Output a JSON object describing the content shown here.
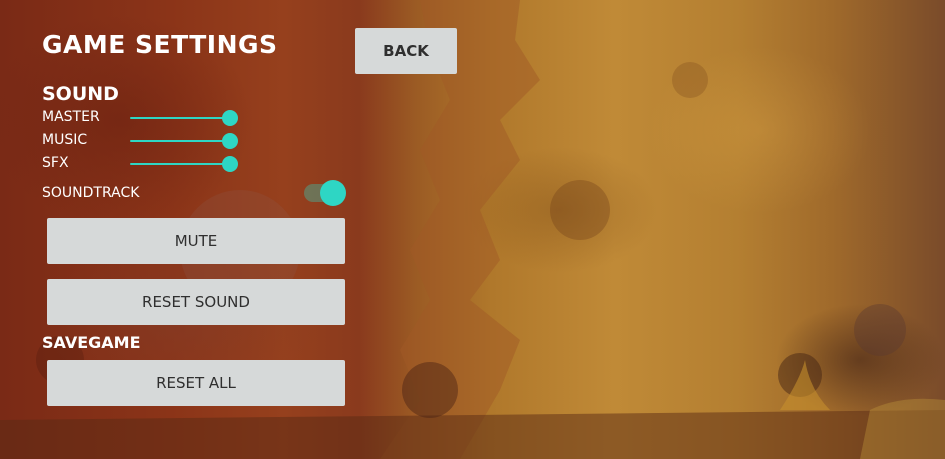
{
  "header": {
    "title": "GAME SETTINGS",
    "back_label": "BACK"
  },
  "sound": {
    "section_label": "SOUND",
    "sliders": [
      {
        "label": "MASTER",
        "value": 0.91
      },
      {
        "label": "MUSIC",
        "value": 0.91
      },
      {
        "label": "SFX",
        "value": 0.91
      }
    ],
    "soundtrack": {
      "label": "SOUNDTRACK",
      "on": true
    },
    "mute_label": "MUTE",
    "reset_sound_label": "RESET SOUND"
  },
  "savegame": {
    "section_label": "SAVEGAME",
    "reset_all_label": "RESET ALL"
  },
  "colors": {
    "accent": "#2ed6c4",
    "button_bg": "#d6d9d9",
    "button_text": "#2f2f2f",
    "text": "#ffffff"
  }
}
